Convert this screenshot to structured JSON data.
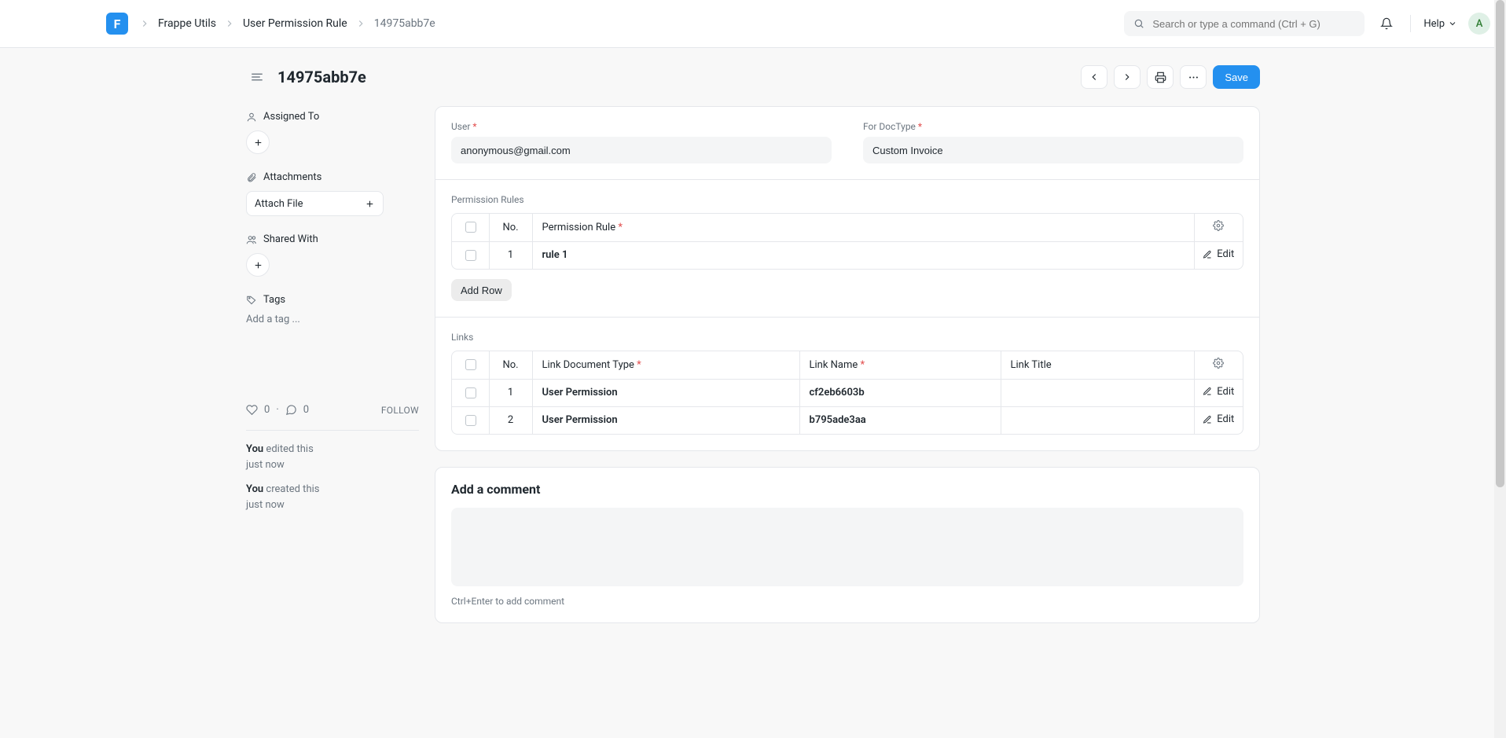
{
  "logo_letter": "F",
  "breadcrumbs": {
    "items": [
      "Frappe Utils",
      "User Permission Rule"
    ],
    "current": "14975abb7e"
  },
  "search": {
    "placeholder": "Search or type a command (Ctrl + G)"
  },
  "help_label": "Help",
  "avatar_letter": "A",
  "page": {
    "title": "14975abb7e",
    "save_label": "Save"
  },
  "sidebar": {
    "assigned_to_label": "Assigned To",
    "attachments_label": "Attachments",
    "attach_file_label": "Attach File",
    "shared_with_label": "Shared With",
    "tags_label": "Tags",
    "tags_placeholder": "Add a tag ...",
    "likes_count": "0",
    "comments_count": "0",
    "follow_label": "FOLLOW",
    "activity": [
      {
        "who": "You",
        "text": " edited this",
        "time": "just now"
      },
      {
        "who": "You",
        "text": " created this",
        "time": "just now"
      }
    ]
  },
  "form": {
    "user_label": "User",
    "user_value": "anonymous@gmail.com",
    "doctype_label": "For DocType",
    "doctype_value": "Custom Invoice"
  },
  "perm_rules": {
    "section_label": "Permission Rules",
    "col_no": "No.",
    "col_rule": "Permission Rule",
    "rows": [
      {
        "no": "1",
        "rule": "rule 1"
      }
    ],
    "add_row_label": "Add Row",
    "edit_label": "Edit"
  },
  "links": {
    "section_label": "Links",
    "col_no": "No.",
    "col_ldt": "Link Document Type",
    "col_lname": "Link Name",
    "col_ltitle": "Link Title",
    "edit_label": "Edit",
    "rows": [
      {
        "no": "1",
        "ldt": "User Permission",
        "lname": "cf2eb6603b",
        "ltitle": ""
      },
      {
        "no": "2",
        "ldt": "User Permission",
        "lname": "b795ade3aa",
        "ltitle": ""
      }
    ]
  },
  "comment": {
    "title": "Add a comment",
    "hint": "Ctrl+Enter to add comment"
  }
}
